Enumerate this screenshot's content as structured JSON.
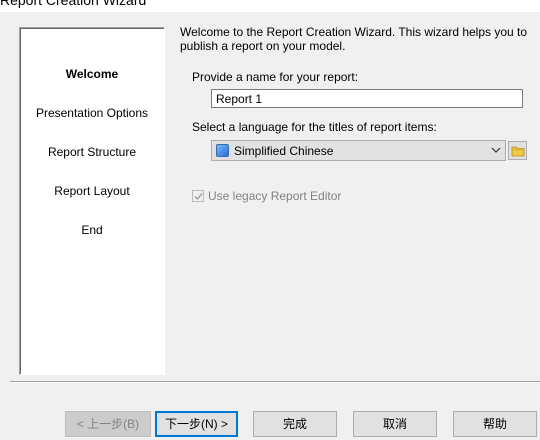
{
  "window": {
    "title": "Report Creation Wizard"
  },
  "sidebar": {
    "items": [
      {
        "label": "Welcome",
        "active": true
      },
      {
        "label": "Presentation Options"
      },
      {
        "label": "Report Structure"
      },
      {
        "label": "Report Layout"
      },
      {
        "label": "End"
      }
    ]
  },
  "intro": "Welcome to the Report Creation Wizard. This wizard helps you to publish a report on your model.",
  "name_field": {
    "label": "Provide a name for your report:",
    "value": "Report 1"
  },
  "language_field": {
    "label": "Select a language for the titles of report items:",
    "selected": "Simplified Chinese",
    "icon": "language-flag-icon"
  },
  "legacy_checkbox": {
    "label": "Use legacy Report Editor",
    "checked": true,
    "disabled": true
  },
  "buttons": {
    "back": "< 上一步(B)",
    "next": "下一步(N) >",
    "finish": "完成",
    "cancel": "取消",
    "help": "帮助"
  },
  "colors": {
    "focus_border": "#0078d7",
    "dialog_bg": "#f0f0f0"
  }
}
